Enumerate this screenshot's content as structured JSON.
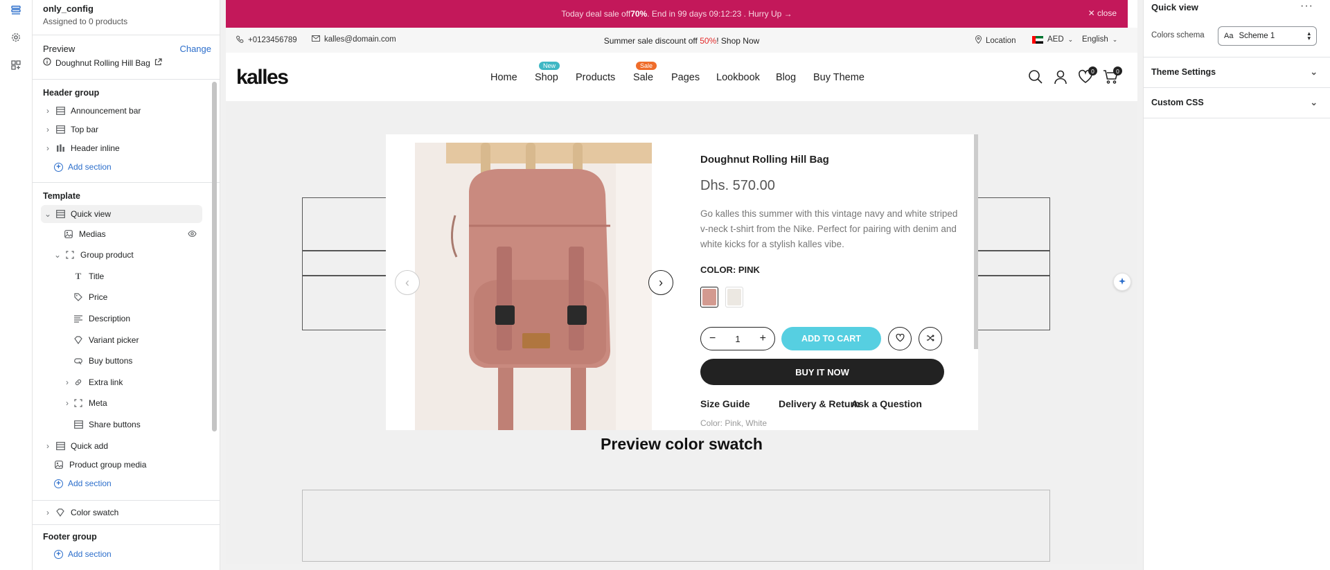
{
  "sidebar": {
    "title": "only_config",
    "subtitle": "Assigned to 0 products",
    "preview_label": "Preview",
    "change_label": "Change",
    "preview_product": "Doughnut Rolling Hill Bag",
    "header_group": {
      "heading": "Header group",
      "items": [
        "Announcement bar",
        "Top bar",
        "Header inline"
      ],
      "add_label": "Add section"
    },
    "template": {
      "heading": "Template",
      "quick_view": "Quick view",
      "medias": "Medias",
      "group_product": "Group product",
      "blocks": [
        "Title",
        "Price",
        "Description",
        "Variant picker",
        "Buy buttons",
        "Extra link",
        "Meta",
        "Share buttons"
      ],
      "quick_add": "Quick add",
      "product_group_media": "Product group media",
      "add_label": "Add section"
    },
    "color_swatch": "Color swatch",
    "footer_group": {
      "heading": "Footer group",
      "add_label": "Add section"
    }
  },
  "store": {
    "promo": {
      "text_before": "Today deal sale off ",
      "highlight": "70%",
      "text_after": ". End in 99 days 09:12:23 .  Hurry Up →",
      "close_label": "close"
    },
    "topbar": {
      "phone": "+0123456789",
      "email": "kalles@domain.com",
      "center_before": "Summer sale discount off ",
      "center_highlight": "50%",
      "center_after": "! Shop Now",
      "location": "Location",
      "currency": "AED",
      "language": "English"
    },
    "nav": {
      "logo": "kalles",
      "items": [
        "Home",
        "Shop",
        "Products",
        "Sale",
        "Pages",
        "Lookbook",
        "Blog",
        "Buy Theme"
      ],
      "shop_badge": "New",
      "sale_badge": "Sale",
      "wishlist_count": "0",
      "cart_count": "0"
    },
    "swatch_heading": "Preview color swatch"
  },
  "modal": {
    "title": "Doughnut Rolling Hill Bag",
    "price": "Dhs. 570.00",
    "description": "Go kalles this summer with this vintage navy and white striped v-neck t-shirt from the Nike. Perfect for pairing with denim and white kicks for a stylish kalles vibe.",
    "color_label": "COLOR: PINK",
    "quantity": "1",
    "add_to_cart": "ADD TO CART",
    "buy_now": "BUY IT NOW",
    "links": [
      "Size Guide",
      "Delivery & Return",
      "Ask a Question"
    ],
    "cut_text": "Color: Pink, White"
  },
  "right_panel": {
    "title": "Quick view",
    "more": "···",
    "colors_schema_label": "Colors schema",
    "colors_schema_value": "Scheme 1",
    "sections": [
      "Theme Settings",
      "Custom CSS"
    ]
  },
  "colors": {
    "promo_bg": "#c3185a",
    "accent": "#2c6ecb",
    "add_to_cart_bg": "#56cfe1",
    "product_pink": "#c98a7f"
  }
}
